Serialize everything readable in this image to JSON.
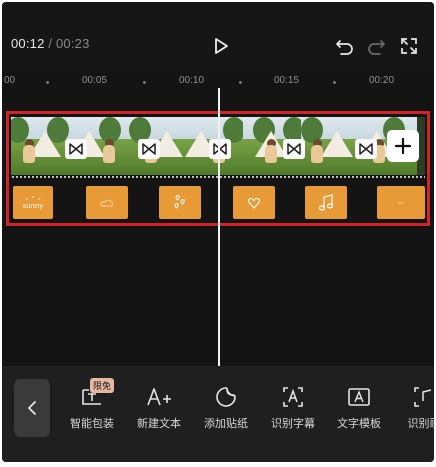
{
  "timecode": {
    "current": "00:12",
    "separator": "/",
    "total": "00:23"
  },
  "icons": {
    "play": "play-icon",
    "undo": "undo-icon",
    "redo": "redo-icon",
    "fullscreen": "fullscreen-icon"
  },
  "ruler": {
    "labels": [
      "00",
      "00:05",
      "00:10",
      "00:15",
      "00:20"
    ]
  },
  "timeline": {
    "video_clips": 6,
    "transition_icon": "bowtie-transition-icon",
    "add_icon": "plus-icon",
    "sticker_icons": [
      "sunny-sticker",
      "cloud-sticker",
      "hearts-sticker",
      "heart-sticker",
      "music-note-sticker",
      "sparkle-sticker"
    ],
    "sticker_text": "sunny"
  },
  "toolbar": {
    "tools": [
      {
        "label": "智能包装",
        "badge": "限免"
      },
      {
        "label": "新建文本"
      },
      {
        "label": "添加贴纸"
      },
      {
        "label": "识别字幕"
      },
      {
        "label": "文字模板"
      },
      {
        "label": "识别歌"
      }
    ]
  },
  "colors": {
    "accent_red": "#d2232a",
    "sticker_orange": "#e89a36",
    "background": "#141414"
  }
}
